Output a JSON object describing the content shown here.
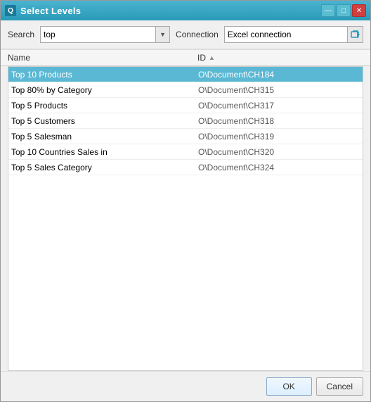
{
  "window": {
    "title": "Select Levels",
    "icon_label": "Q"
  },
  "title_controls": {
    "minimize": "—",
    "maximize": "□",
    "close": "✕"
  },
  "toolbar": {
    "search_label": "Search",
    "search_value": "top",
    "search_dropdown_arrow": "▼",
    "connection_label": "Connection",
    "connection_value": "Excel connection",
    "connection_icon": "→"
  },
  "table": {
    "columns": [
      {
        "key": "name",
        "label": "Name",
        "sort_indicator": ""
      },
      {
        "key": "id",
        "label": "ID",
        "sort_indicator": "▲"
      }
    ],
    "rows": [
      {
        "name": "Top 10 Products",
        "id": "O\\Document\\CH184",
        "selected": true
      },
      {
        "name": "Top 80% by Category",
        "id": "O\\Document\\CH315",
        "selected": false
      },
      {
        "name": "Top 5 Products",
        "id": "O\\Document\\CH317",
        "selected": false
      },
      {
        "name": "Top 5 Customers",
        "id": "O\\Document\\CH318",
        "selected": false
      },
      {
        "name": "Top 5 Salesman",
        "id": "O\\Document\\CH319",
        "selected": false
      },
      {
        "name": "Top 10 Countries Sales in",
        "id": "O\\Document\\CH320",
        "selected": false
      },
      {
        "name": "Top 5 Sales Category",
        "id": "O\\Document\\CH324",
        "selected": false
      }
    ]
  },
  "footer": {
    "ok_label": "OK",
    "cancel_label": "Cancel"
  }
}
